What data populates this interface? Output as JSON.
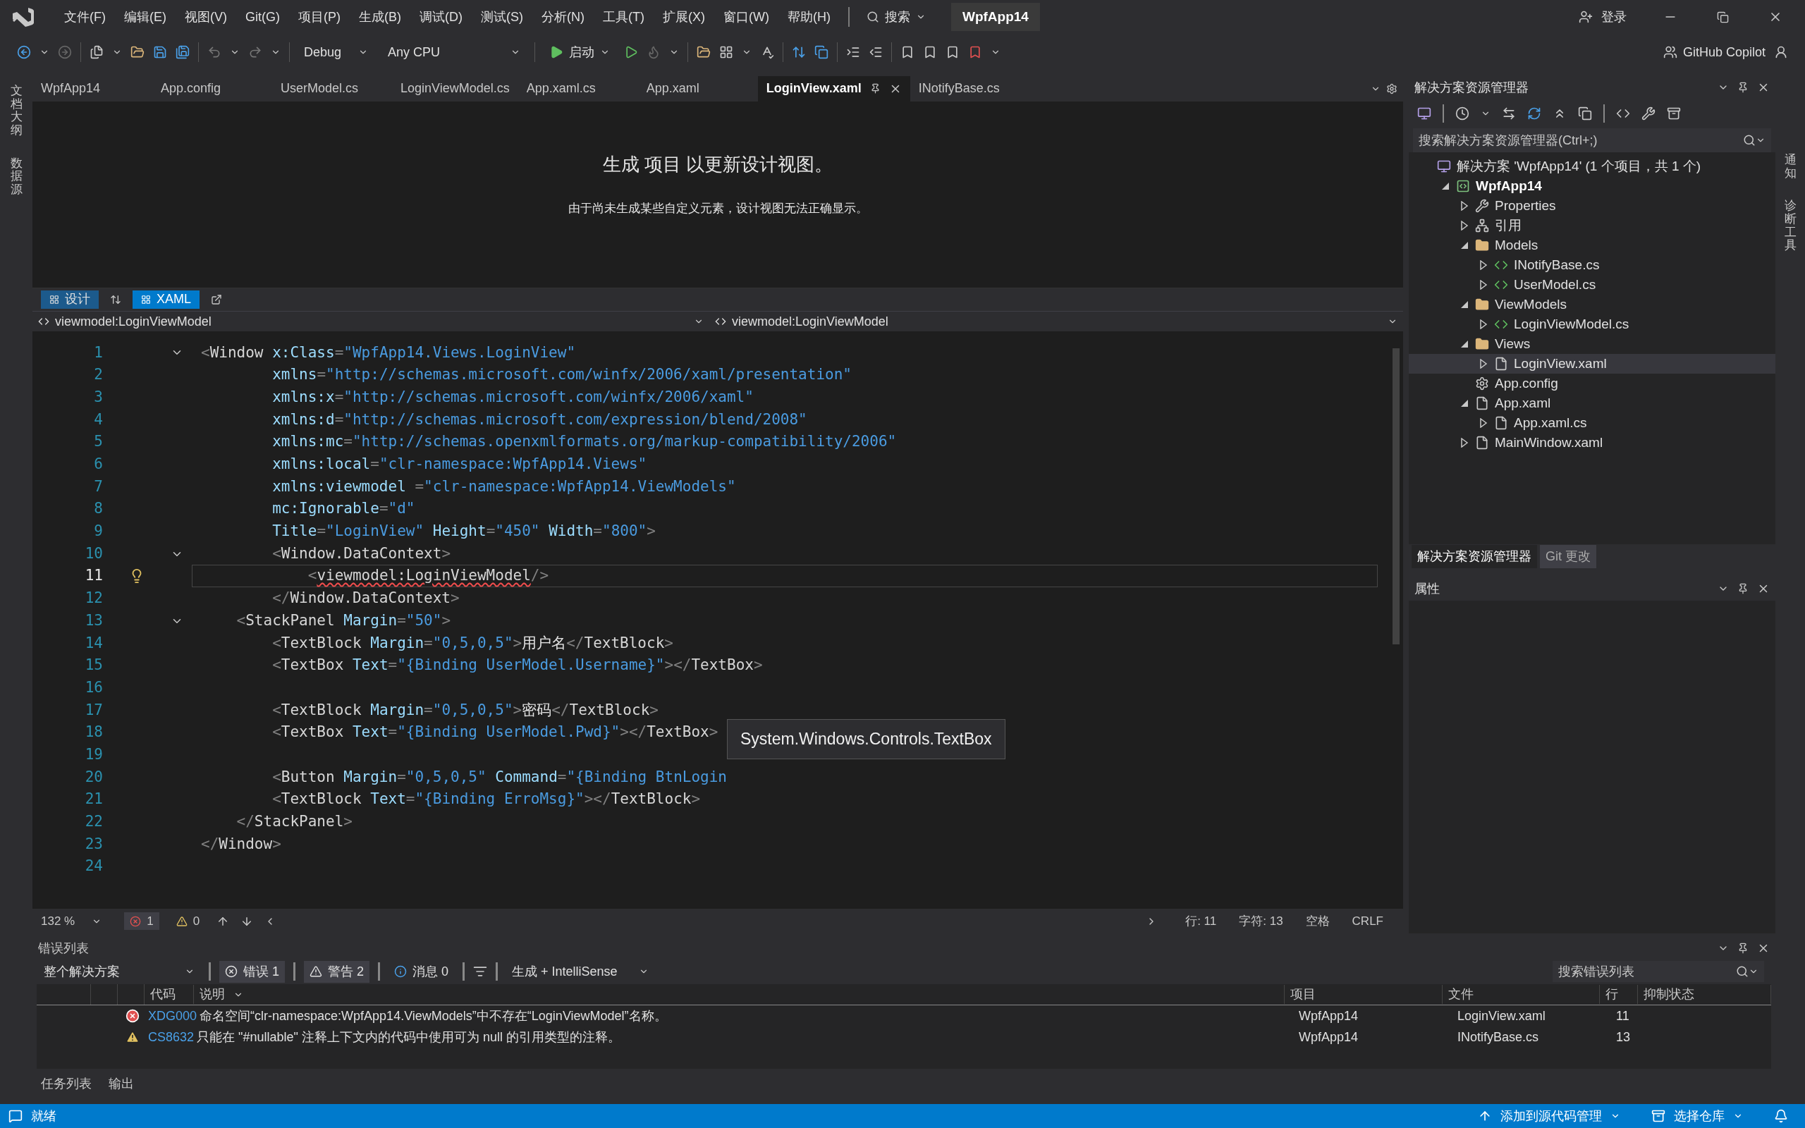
{
  "title_bar": {
    "menus": [
      "文件(F)",
      "编辑(E)",
      "视图(V)",
      "Git(G)",
      "项目(P)",
      "生成(B)",
      "调试(D)",
      "测试(S)",
      "分析(N)",
      "工具(T)",
      "扩展(X)",
      "窗口(W)",
      "帮助(H)"
    ],
    "search": "搜索",
    "solution_name": "WpfApp14",
    "sign_in": "登录"
  },
  "toolbar": {
    "configuration": "Debug",
    "platform": "Any CPU",
    "start": "启动",
    "copilot": "GitHub Copilot"
  },
  "left_rail": [
    "文档大纲",
    "数据源"
  ],
  "right_rail": [
    "通知",
    "诊断工具"
  ],
  "tabs": [
    {
      "label": "WpfApp14",
      "selected": false
    },
    {
      "label": "App.config",
      "selected": false
    },
    {
      "label": "UserModel.cs",
      "selected": false
    },
    {
      "label": "LoginViewModel.cs",
      "selected": false
    },
    {
      "label": "App.xaml.cs",
      "selected": false
    },
    {
      "label": "App.xaml",
      "selected": false
    },
    {
      "label": "LoginView.xaml",
      "selected": true
    },
    {
      "label": "INotifyBase.cs",
      "selected": false
    }
  ],
  "design_view": {
    "message": "生成 项目 以更新设计视图。",
    "detail": "由于尚未生成某些自定义元素，设计视图无法正确显示。"
  },
  "view_tabs": [
    {
      "label": "设计",
      "selected": false
    },
    {
      "label": "XAML",
      "selected": true
    }
  ],
  "nav_bar": {
    "left": "viewmodel:LoginViewModel",
    "right": "viewmodel:LoginViewModel"
  },
  "code_lines": [
    {
      "n": "1",
      "fold": true,
      "current": false,
      "tokens": [
        {
          "kind": "bracket",
          "text": "<"
        },
        {
          "kind": "element",
          "text": "Window"
        },
        {
          "kind": "attribute",
          "text": " x:Class"
        },
        {
          "kind": "bracket",
          "text": "="
        },
        {
          "kind": "value",
          "text": "\"WpfApp14.Views.LoginView\""
        }
      ]
    },
    {
      "n": "2",
      "fold": false,
      "current": false,
      "tokens": [
        {
          "kind": "attribute",
          "text": "        xmlns"
        },
        {
          "kind": "bracket",
          "text": "="
        },
        {
          "kind": "value",
          "text": "\"http://schemas.microsoft.com/winfx/2006/xaml/presentation\""
        }
      ]
    },
    {
      "n": "3",
      "fold": false,
      "current": false,
      "tokens": [
        {
          "kind": "attribute",
          "text": "        xmlns:x"
        },
        {
          "kind": "bracket",
          "text": "="
        },
        {
          "kind": "value",
          "text": "\"http://schemas.microsoft.com/winfx/2006/xaml\""
        }
      ]
    },
    {
      "n": "4",
      "fold": false,
      "current": false,
      "tokens": [
        {
          "kind": "attribute",
          "text": "        xmlns:d"
        },
        {
          "kind": "bracket",
          "text": "="
        },
        {
          "kind": "value",
          "text": "\"http://schemas.microsoft.com/expression/blend/2008\""
        }
      ]
    },
    {
      "n": "5",
      "fold": false,
      "current": false,
      "tokens": [
        {
          "kind": "attribute",
          "text": "        xmlns:mc"
        },
        {
          "kind": "bracket",
          "text": "="
        },
        {
          "kind": "value",
          "text": "\"http://schemas.openxmlformats.org/markup-compatibility/2006\""
        }
      ]
    },
    {
      "n": "6",
      "fold": false,
      "current": false,
      "tokens": [
        {
          "kind": "attribute",
          "text": "        xmlns:local"
        },
        {
          "kind": "bracket",
          "text": "="
        },
        {
          "kind": "value",
          "text": "\"clr-namespace:WpfApp14.Views\""
        }
      ]
    },
    {
      "n": "7",
      "fold": false,
      "current": false,
      "tokens": [
        {
          "kind": "attribute",
          "text": "        xmlns:viewmodel "
        },
        {
          "kind": "bracket",
          "text": "="
        },
        {
          "kind": "value",
          "text": "\"clr-namespace:WpfApp14.ViewModels\""
        }
      ]
    },
    {
      "n": "8",
      "fold": false,
      "current": false,
      "tokens": [
        {
          "kind": "attribute",
          "text": "        mc:Ignorable"
        },
        {
          "kind": "bracket",
          "text": "="
        },
        {
          "kind": "value",
          "text": "\"d\""
        }
      ]
    },
    {
      "n": "9",
      "fold": false,
      "current": false,
      "tokens": [
        {
          "kind": "attribute",
          "text": "        Title"
        },
        {
          "kind": "bracket",
          "text": "="
        },
        {
          "kind": "value",
          "text": "\"LoginView\""
        },
        {
          "kind": "attribute",
          "text": " Height"
        },
        {
          "kind": "bracket",
          "text": "="
        },
        {
          "kind": "value",
          "text": "\"450\""
        },
        {
          "kind": "attribute",
          "text": " Width"
        },
        {
          "kind": "bracket",
          "text": "="
        },
        {
          "kind": "value",
          "text": "\"800\""
        },
        {
          "kind": "bracket",
          "text": ">"
        }
      ]
    },
    {
      "n": "10",
      "fold": true,
      "current": false,
      "tokens": [
        {
          "kind": "bracket",
          "text": "        <"
        },
        {
          "kind": "element",
          "text": "Window.DataContext"
        },
        {
          "kind": "bracket",
          "text": ">"
        }
      ]
    },
    {
      "n": "11",
      "fold": false,
      "current": true,
      "tokens": [
        {
          "kind": "bracket",
          "text": "            <"
        },
        {
          "kind": "error",
          "text": "viewmodel:LoginViewModel"
        },
        {
          "kind": "bracket",
          "text": "/>"
        }
      ]
    },
    {
      "n": "12",
      "fold": false,
      "current": false,
      "tokens": [
        {
          "kind": "bracket",
          "text": "        </"
        },
        {
          "kind": "element",
          "text": "Window.DataContext"
        },
        {
          "kind": "bracket",
          "text": ">"
        }
      ]
    },
    {
      "n": "13",
      "fold": true,
      "current": false,
      "tokens": [
        {
          "kind": "bracket",
          "text": "    <"
        },
        {
          "kind": "element",
          "text": "StackPanel"
        },
        {
          "kind": "attribute",
          "text": " Margin"
        },
        {
          "kind": "bracket",
          "text": "="
        },
        {
          "kind": "value",
          "text": "\"50\""
        },
        {
          "kind": "bracket",
          "text": ">"
        }
      ]
    },
    {
      "n": "14",
      "fold": false,
      "current": false,
      "tokens": [
        {
          "kind": "bracket",
          "text": "        <"
        },
        {
          "kind": "element",
          "text": "TextBlock"
        },
        {
          "kind": "attribute",
          "text": " Margin"
        },
        {
          "kind": "bracket",
          "text": "="
        },
        {
          "kind": "value",
          "text": "\"0,5,0,5\""
        },
        {
          "kind": "bracket",
          "text": ">"
        },
        {
          "kind": "text",
          "text": "用户名"
        },
        {
          "kind": "bracket",
          "text": "</"
        },
        {
          "kind": "element",
          "text": "TextBlock"
        },
        {
          "kind": "bracket",
          "text": ">"
        }
      ]
    },
    {
      "n": "15",
      "fold": false,
      "current": false,
      "tokens": [
        {
          "kind": "bracket",
          "text": "        <"
        },
        {
          "kind": "element",
          "text": "TextBox"
        },
        {
          "kind": "attribute",
          "text": " Text"
        },
        {
          "kind": "bracket",
          "text": "="
        },
        {
          "kind": "value",
          "text": "\"{Binding UserModel.Username}\""
        },
        {
          "kind": "bracket",
          "text": "></"
        },
        {
          "kind": "element",
          "text": "TextBox"
        },
        {
          "kind": "bracket",
          "text": ">"
        }
      ]
    },
    {
      "n": "16",
      "fold": false,
      "current": false
    },
    {
      "n": "17",
      "fold": false,
      "current": false,
      "tokens": [
        {
          "kind": "bracket",
          "text": "        <"
        },
        {
          "kind": "element",
          "text": "TextBlock"
        },
        {
          "kind": "attribute",
          "text": " Margin"
        },
        {
          "kind": "bracket",
          "text": "="
        },
        {
          "kind": "value",
          "text": "\"0,5,0,5\""
        },
        {
          "kind": "bracket",
          "text": ">"
        },
        {
          "kind": "text",
          "text": "密码"
        },
        {
          "kind": "bracket",
          "text": "</"
        },
        {
          "kind": "element",
          "text": "TextBlock"
        },
        {
          "kind": "bracket",
          "text": ">"
        }
      ]
    },
    {
      "n": "18",
      "fold": false,
      "current": false,
      "tokens": [
        {
          "kind": "bracket",
          "text": "        <"
        },
        {
          "kind": "element",
          "text": "TextBox"
        },
        {
          "kind": "attribute",
          "text": " Text"
        },
        {
          "kind": "bracket",
          "text": "="
        },
        {
          "kind": "value",
          "text": "\"{Binding UserModel.Pwd}\""
        },
        {
          "kind": "bracket",
          "text": "></"
        },
        {
          "kind": "element",
          "text": "TextBox"
        },
        {
          "kind": "bracket",
          "text": ">"
        }
      ]
    },
    {
      "n": "19",
      "fold": false,
      "current": false
    },
    {
      "n": "20",
      "fold": false,
      "current": false,
      "tokens": [
        {
          "kind": "bracket",
          "text": "        <"
        },
        {
          "kind": "element",
          "text": "Button"
        },
        {
          "kind": "attribute",
          "text": " Margin"
        },
        {
          "kind": "bracket",
          "text": "="
        },
        {
          "kind": "value",
          "text": "\"0,5,0,5\""
        },
        {
          "kind": "attribute",
          "text": " Command"
        },
        {
          "kind": "bracket",
          "text": "="
        },
        {
          "kind": "value",
          "text": "\"{Binding BtnLogin"
        }
      ]
    },
    {
      "n": "21",
      "fold": false,
      "current": false,
      "tokens": [
        {
          "kind": "bracket",
          "text": "        <"
        },
        {
          "kind": "element",
          "text": "TextBlock"
        },
        {
          "kind": "attribute",
          "text": " Text"
        },
        {
          "kind": "bracket",
          "text": "="
        },
        {
          "kind": "value",
          "text": "\"{Binding ErroMsg}\""
        },
        {
          "kind": "bracket",
          "text": "></"
        },
        {
          "kind": "element",
          "text": "TextBlock"
        },
        {
          "kind": "bracket",
          "text": ">"
        }
      ]
    },
    {
      "n": "22",
      "fold": false,
      "current": false,
      "tokens": [
        {
          "kind": "bracket",
          "text": "    </"
        },
        {
          "kind": "element",
          "text": "StackPanel"
        },
        {
          "kind": "bracket",
          "text": ">"
        }
      ]
    },
    {
      "n": "23",
      "fold": false,
      "current": false,
      "tokens": [
        {
          "kind": "bracket",
          "text": "</"
        },
        {
          "kind": "element",
          "text": "Window"
        },
        {
          "kind": "bracket",
          "text": ">"
        }
      ]
    },
    {
      "n": "24",
      "fold": false,
      "current": false
    }
  ],
  "tooltip": "System.Windows.Controls.TextBox",
  "editor_status": {
    "zoom": "132 %",
    "errors": "1",
    "warnings": "0",
    "line": "行: 11",
    "column": "字符: 13",
    "indent": "空格",
    "line_ending": "CRLF"
  },
  "solution_explorer": {
    "title": "解决方案资源管理器",
    "search_placeholder": "搜索解决方案资源管理器(Ctrl+;)",
    "tree": [
      {
        "label": "解决方案 'WpfApp14' (1 个项目，共 1 个)",
        "kind": "solution",
        "selected": false,
        "children": [
          {
            "label": "WpfApp14",
            "kind": "project",
            "expanded": true,
            "selected": false,
            "children": [
              {
                "label": "Properties",
                "kind": "properties",
                "expanded": false,
                "selected": false
              },
              {
                "label": "引用",
                "kind": "references",
                "expanded": false,
                "selected": false
              },
              {
                "label": "Models",
                "kind": "folder",
                "expanded": true,
                "selected": false,
                "children": [
                  {
                    "label": "INotifyBase.cs",
                    "kind": "csharp",
                    "expanded": false,
                    "selected": false
                  },
                  {
                    "label": "UserModel.cs",
                    "kind": "csharp",
                    "expanded": false,
                    "selected": false
                  }
                ]
              },
              {
                "label": "ViewModels",
                "kind": "folder",
                "expanded": true,
                "selected": false,
                "children": [
                  {
                    "label": "LoginViewModel.cs",
                    "kind": "csharp",
                    "expanded": false,
                    "selected": false
                  }
                ]
              },
              {
                "label": "Views",
                "kind": "folder",
                "expanded": true,
                "selected": false,
                "children": [
                  {
                    "label": "LoginView.xaml",
                    "kind": "xaml",
                    "expanded": false,
                    "selected": true
                  }
                ]
              },
              {
                "label": "App.config",
                "kind": "config",
                "selected": false
              },
              {
                "label": "App.xaml",
                "kind": "xaml",
                "expanded": true,
                "selected": false,
                "children": [
                  {
                    "label": "App.xaml.cs",
                    "kind": "code",
                    "expanded": false,
                    "selected": false
                  }
                ]
              },
              {
                "label": "MainWindow.xaml",
                "kind": "xaml",
                "expanded": false,
                "selected": false
              }
            ]
          }
        ]
      }
    ],
    "bottom_tabs": [
      {
        "label": "解决方案资源管理器",
        "selected": true
      },
      {
        "label": "Git 更改",
        "selected": false
      }
    ]
  },
  "properties": {
    "title": "属性"
  },
  "error_list": {
    "title": "错误列表",
    "scope": "整个解决方案",
    "errors": "错误 1",
    "warnings": "警告 2",
    "messages": "消息 0",
    "source": "生成 + IntelliSense",
    "search_placeholder": "搜索错误列表",
    "columns": [
      "代码",
      "说明",
      "项目",
      "文件",
      "行",
      "抑制状态"
    ],
    "rows": [
      {
        "kind": "error",
        "code": "XDG000",
        "description": "命名空间“clr-namespace:WpfApp14.ViewModels”中不存在“LoginViewModel”名称。",
        "project": "WpfApp14",
        "file": "LoginView.xaml",
        "line": "11"
      },
      {
        "kind": "warning",
        "code": "CS8632",
        "description": "只能在 \"#nullable\" 注释上下文内的代码中使用可为 null 的引用类型的注释。",
        "project": "WpfApp14",
        "file": "INotifyBase.cs",
        "line": "13"
      }
    ]
  },
  "panel_tabs": [
    "任务列表",
    "输出"
  ],
  "status_bar": {
    "text": "就绪",
    "source_control": "添加到源代码管理",
    "repository": "选择仓库"
  }
}
